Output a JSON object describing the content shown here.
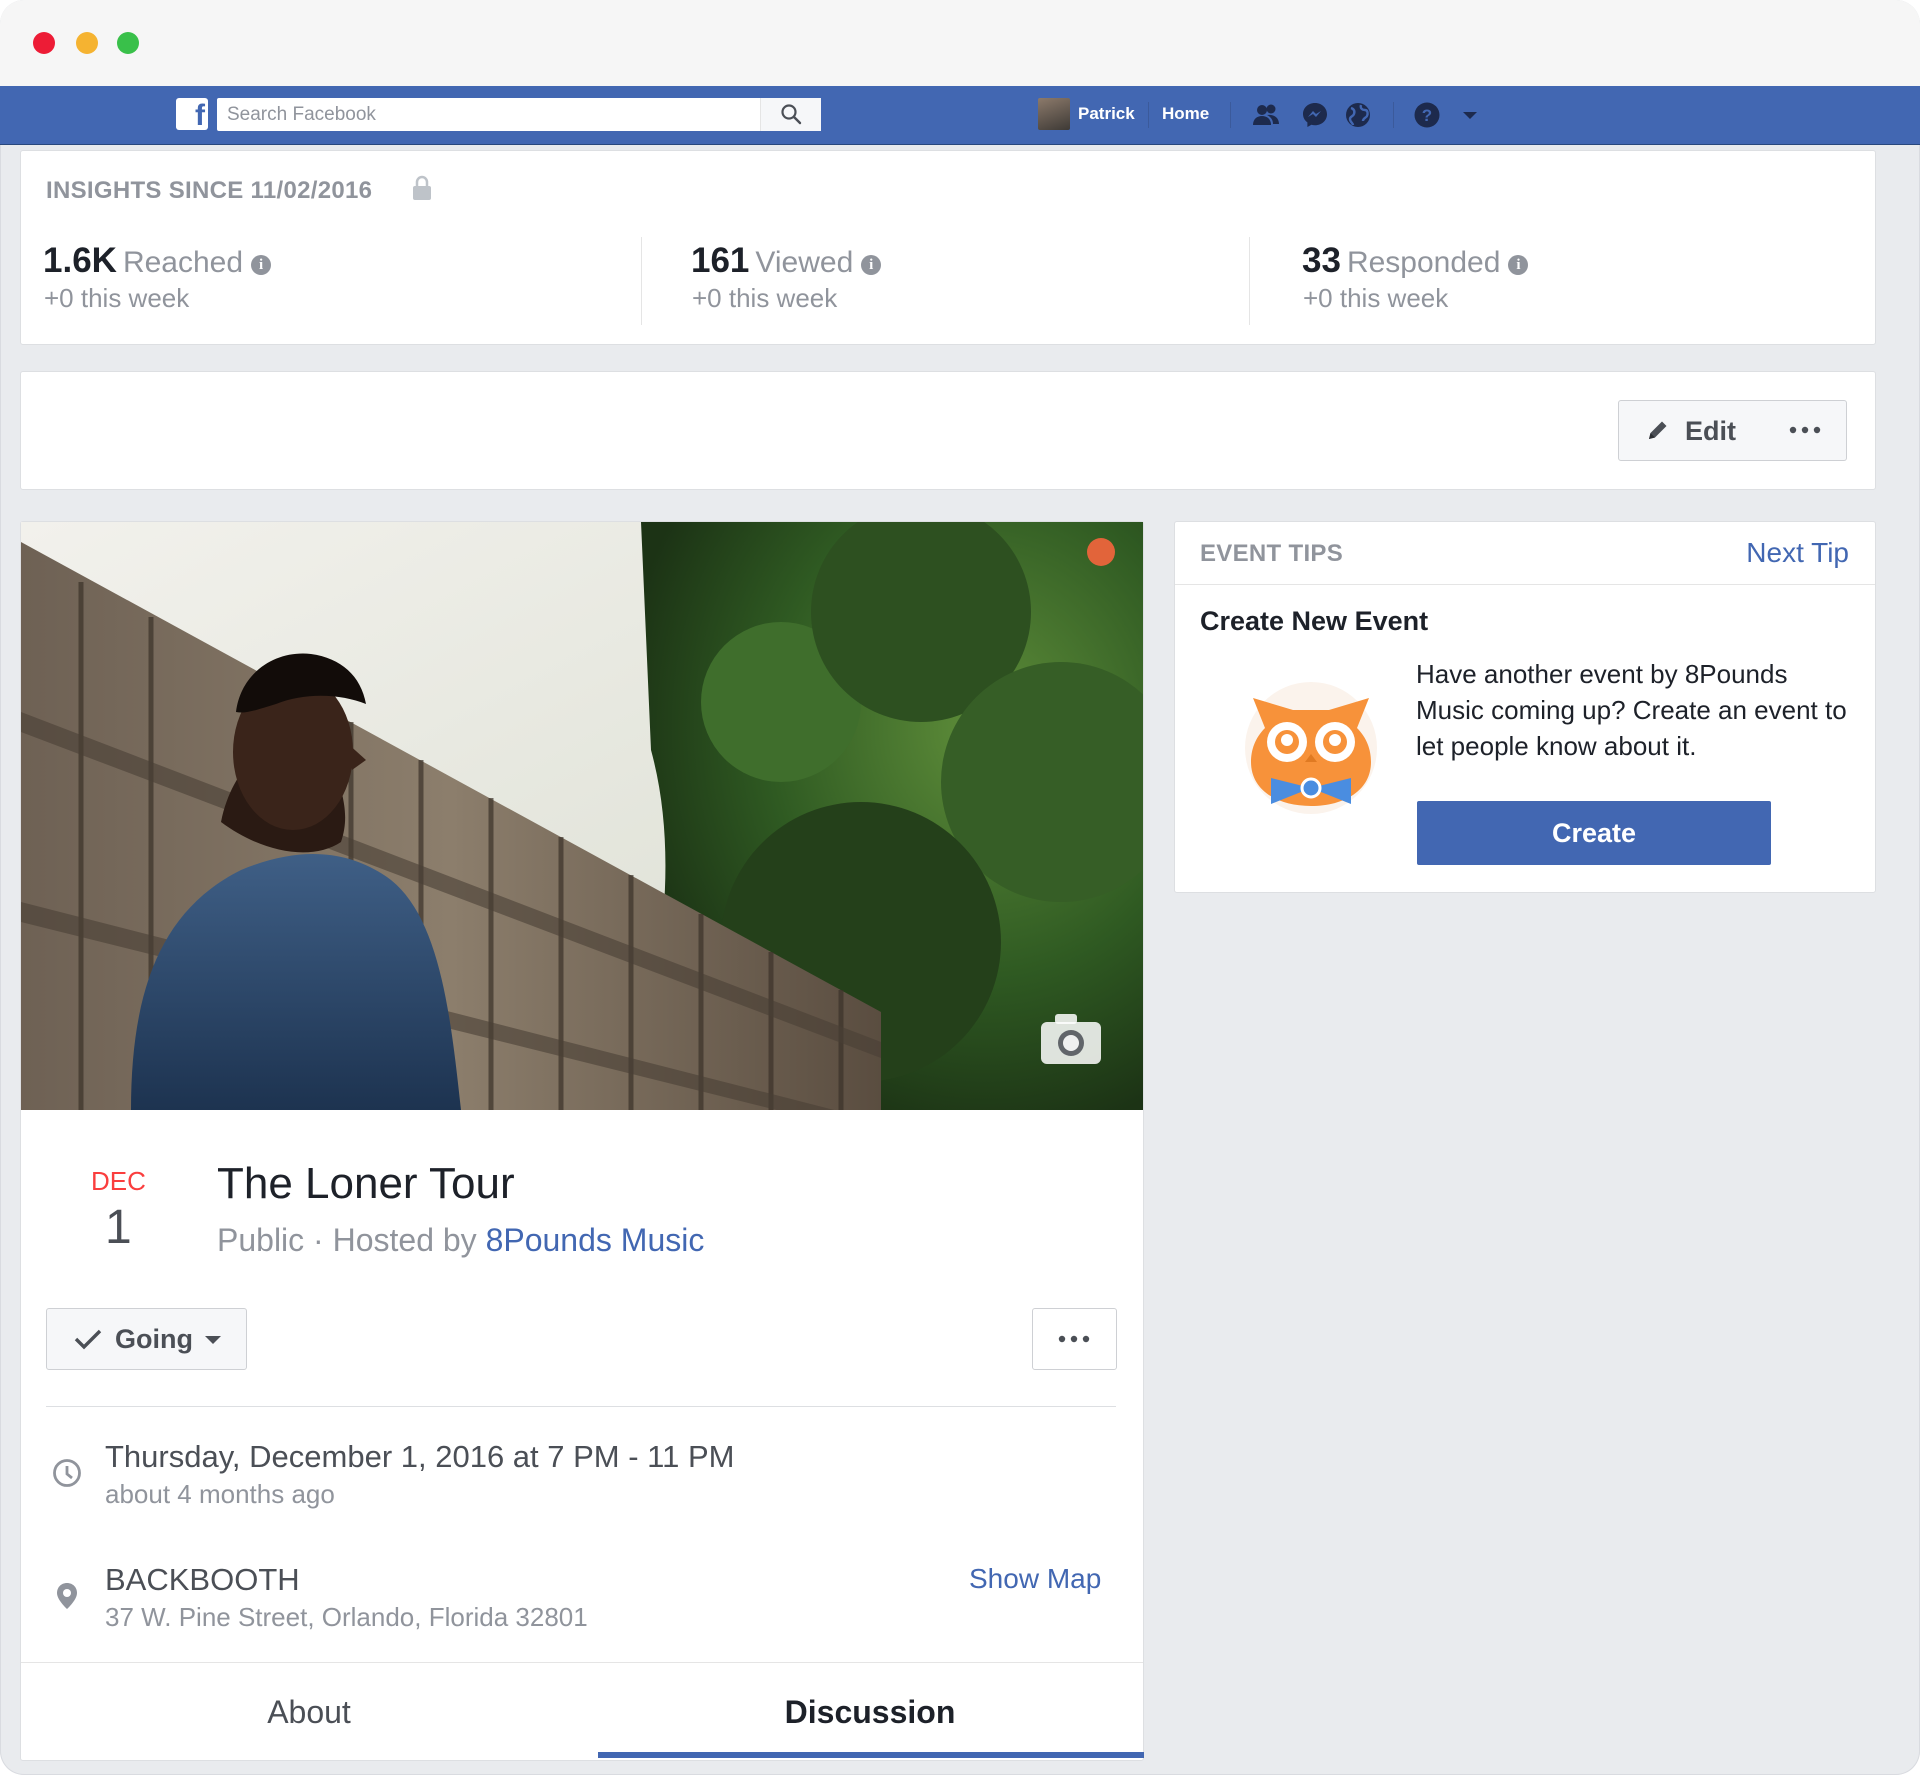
{
  "navbar": {
    "search_placeholder": "Search Facebook",
    "user_name": "Patrick",
    "home_label": "Home"
  },
  "insights": {
    "title": "INSIGHTS SINCE 11/02/2016",
    "metrics": [
      {
        "value": "1.6K",
        "label": "Reached",
        "sub": "+0 this week"
      },
      {
        "value": "161",
        "label": "Viewed",
        "sub": "+0 this week"
      },
      {
        "value": "33",
        "label": "Responded",
        "sub": "+0 this week"
      }
    ]
  },
  "actions": {
    "edit_label": "Edit"
  },
  "event": {
    "month": "DEC",
    "day": "1",
    "title": "The Loner Tour",
    "privacy": "Public · Hosted by ",
    "host": "8Pounds Music",
    "rsvp_label": "Going",
    "datetime": "Thursday, December 1, 2016 at 7 PM - 11 PM",
    "datetime_relative": "about 4 months ago",
    "venue": "BACKBOOTH",
    "address": "37 W. Pine Street, Orlando, Florida 32801",
    "show_map_label": "Show Map",
    "tabs": [
      {
        "label": "About",
        "active": false
      },
      {
        "label": "Discussion",
        "active": true
      }
    ]
  },
  "tips": {
    "title": "EVENT TIPS",
    "next_label": "Next Tip",
    "heading": "Create New Event",
    "text": "Have another event by 8Pounds Music coming up? Create an event to let people know about it.",
    "create_label": "Create"
  },
  "colors": {
    "brand_blue": "#4267b2",
    "date_red": "#fa3e3e",
    "owl_orange": "#f7923a"
  }
}
